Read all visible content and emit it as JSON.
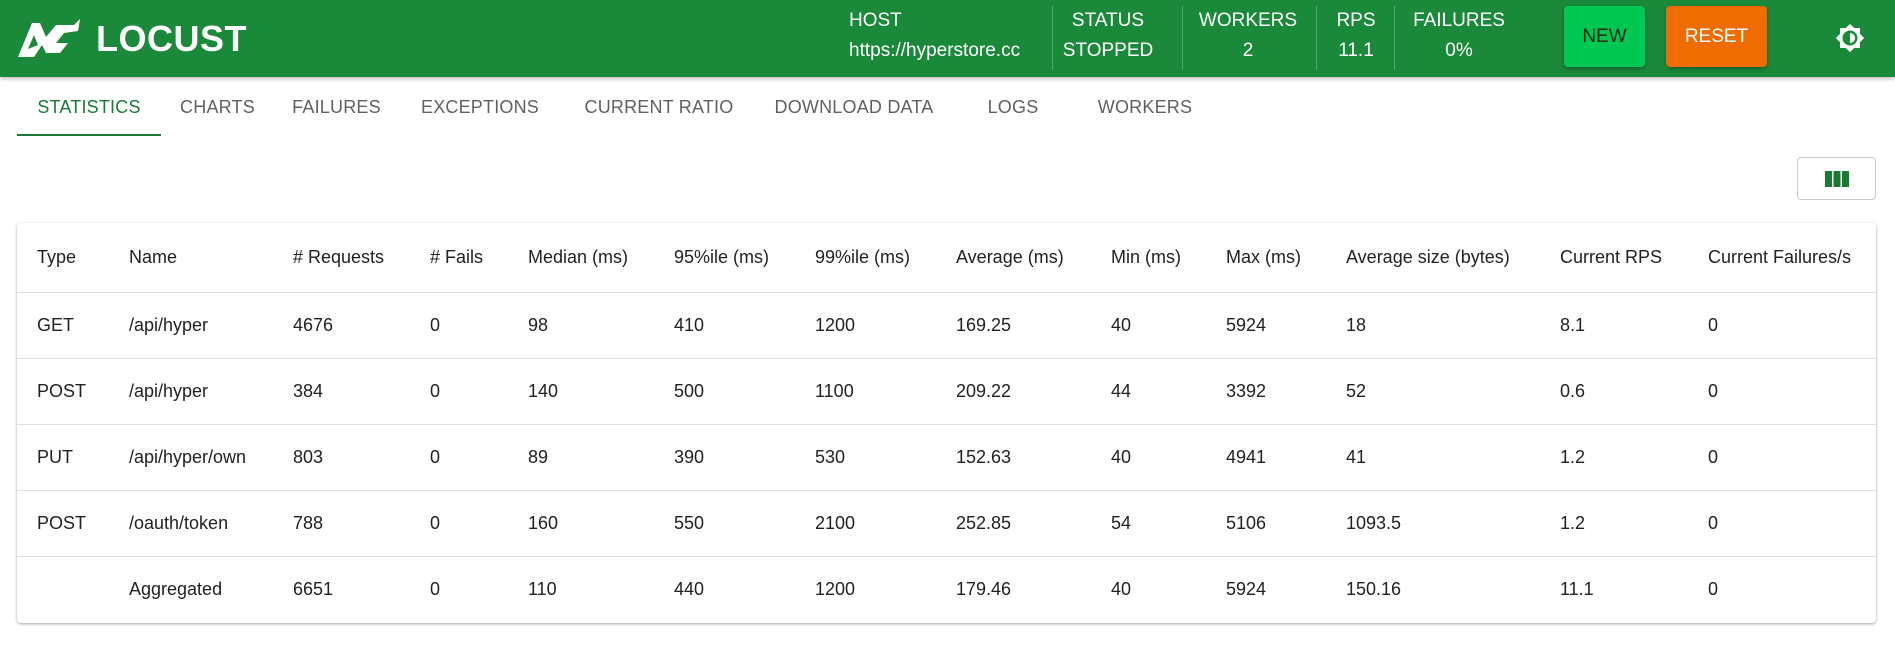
{
  "app": {
    "brand": "LOCUST"
  },
  "header": {
    "stats": [
      {
        "label": "HOST",
        "value": "https://hyperstore.cc"
      },
      {
        "label": "STATUS",
        "value": "STOPPED"
      },
      {
        "label": "WORKERS",
        "value": "2"
      },
      {
        "label": "RPS",
        "value": "11.1"
      },
      {
        "label": "FAILURES",
        "value": "0%"
      }
    ],
    "new_button": "NEW",
    "reset_button": "RESET",
    "theme_icon": "brightness-icon"
  },
  "tabs": [
    {
      "label": "STATISTICS",
      "active": true
    },
    {
      "label": "CHARTS"
    },
    {
      "label": "FAILURES"
    },
    {
      "label": "EXCEPTIONS"
    },
    {
      "label": "CURRENT RATIO"
    },
    {
      "label": "DOWNLOAD DATA"
    },
    {
      "label": "LOGS"
    },
    {
      "label": "WORKERS"
    }
  ],
  "toolbar": {
    "columns_icon": "view-column-icon"
  },
  "colors": {
    "appbar": "#1a8a3a",
    "new_button": "#00c853",
    "reset_button": "#ef6c00",
    "active_tab": "#1a7a33"
  },
  "table": {
    "columns": [
      "Type",
      "Name",
      "# Requests",
      "# Fails",
      "Median (ms)",
      "95%ile (ms)",
      "99%ile (ms)",
      "Average (ms)",
      "Min (ms)",
      "Max (ms)",
      "Average size (bytes)",
      "Current RPS",
      "Current Failures/s"
    ],
    "rows": [
      [
        "GET",
        "/api/hyper",
        "4676",
        "0",
        "98",
        "410",
        "1200",
        "169.25",
        "40",
        "5924",
        "18",
        "8.1",
        "0"
      ],
      [
        "POST",
        "/api/hyper",
        "384",
        "0",
        "140",
        "500",
        "1100",
        "209.22",
        "44",
        "3392",
        "52",
        "0.6",
        "0"
      ],
      [
        "PUT",
        "/api/hyper/own",
        "803",
        "0",
        "89",
        "390",
        "530",
        "152.63",
        "40",
        "4941",
        "41",
        "1.2",
        "0"
      ],
      [
        "POST",
        "/oauth/token",
        "788",
        "0",
        "160",
        "550",
        "2100",
        "252.85",
        "54",
        "5106",
        "1093.5",
        "1.2",
        "0"
      ],
      [
        "",
        "Aggregated",
        "6651",
        "0",
        "110",
        "440",
        "1200",
        "179.46",
        "40",
        "5924",
        "150.16",
        "11.1",
        "0"
      ]
    ]
  }
}
